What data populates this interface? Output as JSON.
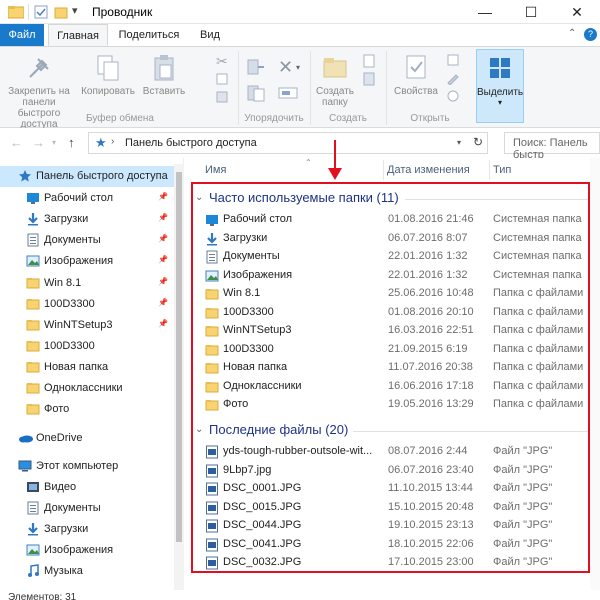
{
  "window": {
    "title": "Проводник",
    "minimize": "—",
    "maximize": "☐",
    "close": "✕",
    "qat_dropdown": "▾"
  },
  "ribbon": {
    "tabs": [
      "Файл",
      "Главная",
      "Поделиться",
      "Вид"
    ],
    "pin_to_quick_access": "Закрепить на панели быстрого доступа",
    "copy": "Копировать",
    "paste": "Вставить",
    "new_folder": "Создать папку",
    "properties": "Свойства",
    "select": "Выделить",
    "groups": {
      "clipboard": "Буфер обмена",
      "organize": "Упорядочить",
      "new": "Создать",
      "open": "Открыть"
    }
  },
  "address": {
    "path": "Панель быстрого доступа",
    "search_placeholder": "Поиск: Панель быстр"
  },
  "navpane": {
    "items": [
      {
        "label": "Панель быстрого доступа",
        "icon": "star-icon",
        "pinned": false,
        "selected": true
      },
      {
        "label": "Рабочий стол",
        "icon": "desktop-icon",
        "pinned": true
      },
      {
        "label": "Загрузки",
        "icon": "download-icon",
        "pinned": true
      },
      {
        "label": "Документы",
        "icon": "documents-icon",
        "pinned": true
      },
      {
        "label": "Изображения",
        "icon": "pictures-icon",
        "pinned": true
      },
      {
        "label": "Win 8.1",
        "icon": "folder-icon",
        "pinned": true
      },
      {
        "label": "100D3300",
        "icon": "folder-icon",
        "pinned": true
      },
      {
        "label": "WinNTSetup3",
        "icon": "folder-icon",
        "pinned": true
      },
      {
        "label": "100D3300",
        "icon": "folder-icon",
        "pinned": false
      },
      {
        "label": "Новая папка",
        "icon": "folder-icon",
        "pinned": false
      },
      {
        "label": "Одноклассники",
        "icon": "folder-icon",
        "pinned": false
      },
      {
        "label": "Фото",
        "icon": "folder-icon",
        "pinned": false
      },
      {
        "label": "OneDrive",
        "icon": "onedrive-icon",
        "pinned": false
      },
      {
        "label": "Этот компьютер",
        "icon": "computer-icon",
        "pinned": false
      },
      {
        "label": "Видео",
        "icon": "video-icon",
        "pinned": false
      },
      {
        "label": "Документы",
        "icon": "documents-icon",
        "pinned": false
      },
      {
        "label": "Загрузки",
        "icon": "download-icon",
        "pinned": false
      },
      {
        "label": "Изображения",
        "icon": "pictures-icon",
        "pinned": false
      },
      {
        "label": "Музыка",
        "icon": "music-icon",
        "pinned": false
      }
    ],
    "pin_glyph": "📌"
  },
  "columns": {
    "name": "Имя",
    "date": "Дата изменения",
    "type": "Тип"
  },
  "frequent": {
    "title": "Часто используемые папки (11)",
    "rows": [
      {
        "name": "Рабочий стол",
        "date": "01.08.2016 21:46",
        "type": "Системная папка",
        "icon": "desktop-icon"
      },
      {
        "name": "Загрузки",
        "date": "06.07.2016 8:07",
        "type": "Системная папка",
        "icon": "download-icon"
      },
      {
        "name": "Документы",
        "date": "22.01.2016 1:32",
        "type": "Системная папка",
        "icon": "documents-icon"
      },
      {
        "name": "Изображения",
        "date": "22.01.2016 1:32",
        "type": "Системная папка",
        "icon": "pictures-icon"
      },
      {
        "name": "Win 8.1",
        "date": "25.06.2016 10:48",
        "type": "Папка с файлами",
        "icon": "folder-icon"
      },
      {
        "name": "100D3300",
        "date": "01.08.2016 20:10",
        "type": "Папка с файлами",
        "icon": "folder-icon"
      },
      {
        "name": "WinNTSetup3",
        "date": "16.03.2016 22:51",
        "type": "Папка с файлами",
        "icon": "folder-icon"
      },
      {
        "name": "100D3300",
        "date": "21.09.2015 6:19",
        "type": "Папка с файлами",
        "icon": "folder-icon"
      },
      {
        "name": "Новая папка",
        "date": "11.07.2016 20:38",
        "type": "Папка с файлами",
        "icon": "folder-icon"
      },
      {
        "name": "Одноклассники",
        "date": "16.06.2016 17:18",
        "type": "Папка с файлами",
        "icon": "folder-icon"
      },
      {
        "name": "Фото",
        "date": "19.05.2016 13:29",
        "type": "Папка с файлами",
        "icon": "folder-icon"
      }
    ]
  },
  "recent": {
    "title": "Последние файлы (20)",
    "rows": [
      {
        "name": "yds-tough-rubber-outsole-wit...",
        "date": "08.07.2016 2:44",
        "type": "Файл \"JPG\""
      },
      {
        "name": "9Lbp7.jpg",
        "date": "06.07.2016 23:40",
        "type": "Файл \"JPG\""
      },
      {
        "name": "DSC_0001.JPG",
        "date": "11.10.2015 13:44",
        "type": "Файл \"JPG\""
      },
      {
        "name": "DSC_0015.JPG",
        "date": "15.10.2015 20:48",
        "type": "Файл \"JPG\""
      },
      {
        "name": "DSC_0044.JPG",
        "date": "19.10.2015 23:13",
        "type": "Файл \"JPG\""
      },
      {
        "name": "DSC_0041.JPG",
        "date": "18.10.2015 22:06",
        "type": "Файл \"JPG\""
      },
      {
        "name": "DSC_0032.JPG",
        "date": "17.10.2015 23:00",
        "type": "Файл \"JPG\""
      }
    ]
  },
  "status": {
    "text": "Элементов: 31"
  },
  "colors": {
    "accent": "#1979ca",
    "highlight": "#e01020",
    "selection": "#cce8ff",
    "group_header": "#1e3287"
  }
}
